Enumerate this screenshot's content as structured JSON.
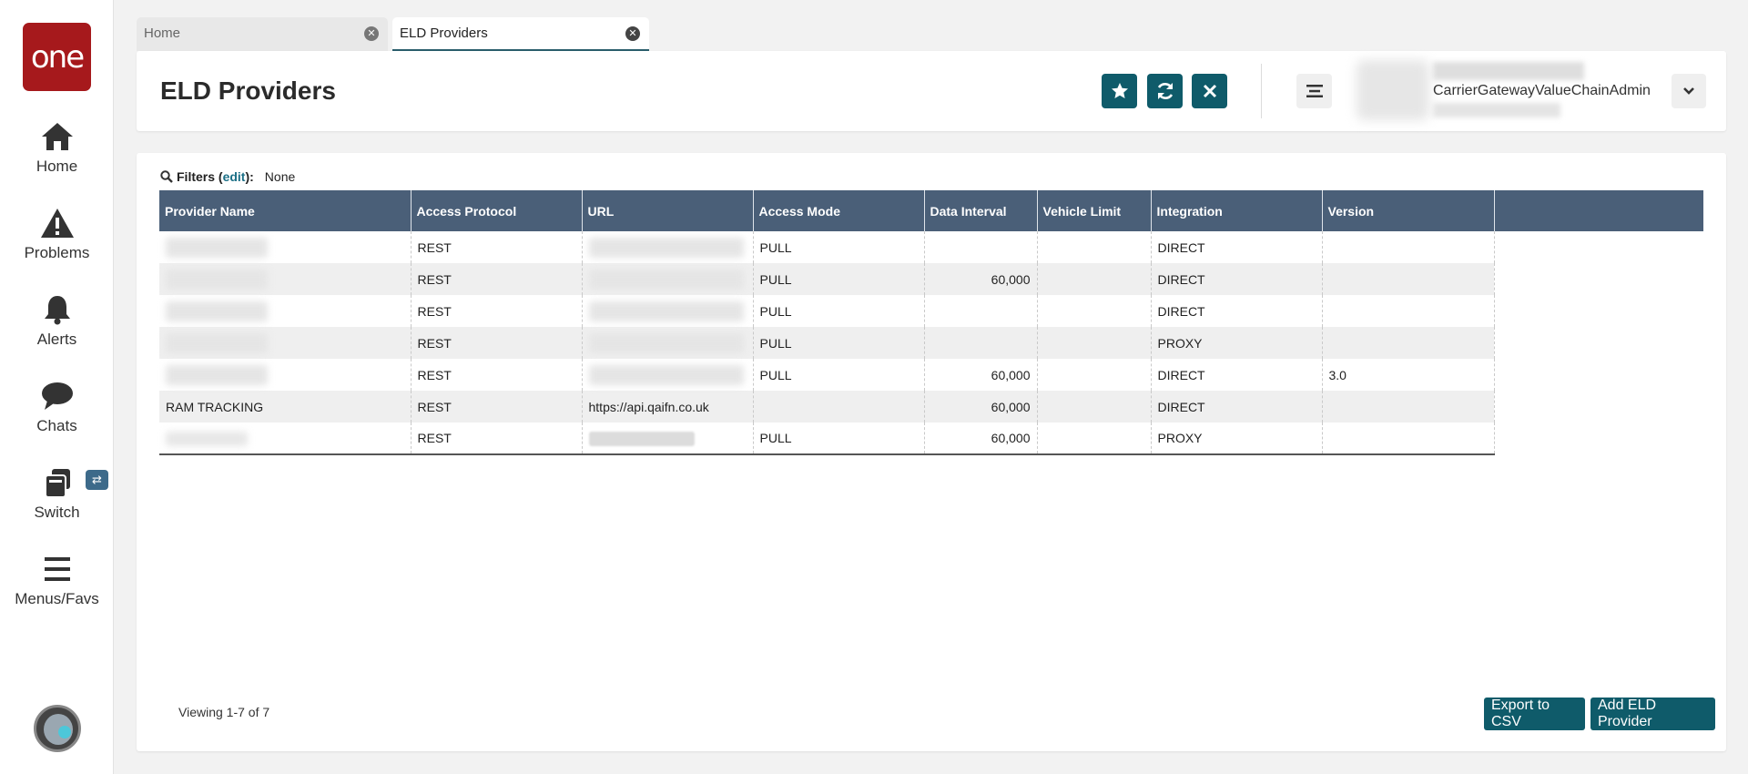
{
  "app": {
    "logo_text": "one"
  },
  "sidebar": {
    "items": [
      {
        "label": "Home",
        "icon": "home-icon"
      },
      {
        "label": "Problems",
        "icon": "warning-icon"
      },
      {
        "label": "Alerts",
        "icon": "bell-icon"
      },
      {
        "label": "Chats",
        "icon": "chat-icon"
      },
      {
        "label": "Switch",
        "icon": "switch-icon"
      },
      {
        "label": "Menus/Favs",
        "icon": "menu-icon"
      }
    ],
    "switch_badge": "⇄"
  },
  "tabs": [
    {
      "label": "Home",
      "active": false
    },
    {
      "label": "ELD Providers",
      "active": true
    }
  ],
  "header": {
    "title": "ELD Providers",
    "user_name": "CarrierGatewayValueChainAdmin"
  },
  "filters": {
    "label": "Filters (",
    "edit_label": "edit",
    "suffix": "):",
    "value": "None"
  },
  "table": {
    "columns": [
      "Provider Name",
      "Access Protocol",
      "URL",
      "Access Mode",
      "Data Interval",
      "Vehicle Limit",
      "Integration",
      "Version"
    ],
    "rows": [
      {
        "provider": "",
        "protocol": "REST",
        "url": "",
        "mode": "PULL",
        "interval": "",
        "limit": "",
        "integration": "DIRECT",
        "version": ""
      },
      {
        "provider": "",
        "protocol": "REST",
        "url": "",
        "mode": "PULL",
        "interval": "60,000",
        "limit": "",
        "integration": "DIRECT",
        "version": ""
      },
      {
        "provider": "",
        "protocol": "REST",
        "url": "",
        "mode": "PULL",
        "interval": "",
        "limit": "",
        "integration": "DIRECT",
        "version": ""
      },
      {
        "provider": "",
        "protocol": "REST",
        "url": "",
        "mode": "PULL",
        "interval": "",
        "limit": "",
        "integration": "PROXY",
        "version": ""
      },
      {
        "provider": "",
        "protocol": "REST",
        "url": "",
        "mode": "PULL",
        "interval": "60,000",
        "limit": "",
        "integration": "DIRECT",
        "version": "3.0"
      },
      {
        "provider": "RAM TRACKING",
        "protocol": "REST",
        "url": "https://api.qaifn.co.uk",
        "mode": "",
        "interval": "60,000",
        "limit": "",
        "integration": "DIRECT",
        "version": ""
      },
      {
        "provider": "",
        "protocol": "REST",
        "url": "",
        "mode": "PULL",
        "interval": "60,000",
        "limit": "",
        "integration": "PROXY",
        "version": ""
      }
    ]
  },
  "footer": {
    "viewing": "Viewing 1-7 of 7",
    "export_label": "Export to CSV",
    "add_label": "Add ELD Provider"
  },
  "colors": {
    "brand_red": "#a6191c",
    "accent_teal": "#0f5b6a",
    "table_header": "#4a5f78",
    "link": "#2b6e80"
  }
}
